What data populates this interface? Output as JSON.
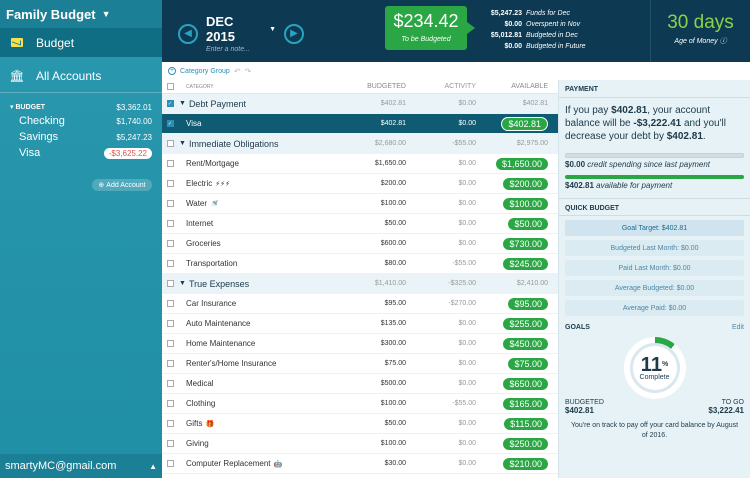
{
  "sidebar": {
    "budget_name": "Family Budget",
    "nav": [
      {
        "label": "Budget",
        "icon": "mail-icon"
      },
      {
        "label": "All Accounts",
        "icon": "bank-icon"
      }
    ],
    "group_label": "BUDGET",
    "group_total": "$3,362.01",
    "accounts": [
      {
        "name": "Checking",
        "balance": "$1,740.00"
      },
      {
        "name": "Savings",
        "balance": "$5,247.23"
      },
      {
        "name": "Visa",
        "balance": "-$3,625.22"
      }
    ],
    "add_account": "Add Account",
    "user_email": "smartyMC@gmail.com"
  },
  "header": {
    "month": "DEC 2015",
    "note_placeholder": "Enter a note...",
    "to_be_budgeted": "$234.42",
    "to_be_budgeted_label": "To be Budgeted",
    "funds": [
      {
        "amount": "$5,247.23",
        "label": "Funds for Dec"
      },
      {
        "amount": "$0.00",
        "label": "Overspent in Nov"
      },
      {
        "amount": "$5,012.81",
        "label": "Budgeted in Dec"
      },
      {
        "amount": "$0.00",
        "label": "Budgeted in Future"
      }
    ],
    "age_of_money": "30 days",
    "age_of_money_label": "Age of Money"
  },
  "toolbar": {
    "category_group": "Category Group"
  },
  "table": {
    "headers": [
      "CATEGORY",
      "BUDGETED",
      "ACTIVITY",
      "AVAILABLE"
    ],
    "rows": [
      {
        "type": "group",
        "name": "Debt Payment",
        "budgeted": "$402.81",
        "activity": "$0.00",
        "available": "$402.81",
        "checked": true
      },
      {
        "type": "item",
        "name": "Visa",
        "budgeted": "$402.81",
        "activity": "$0.00",
        "available": "$402.81",
        "checked": true,
        "selected": true
      },
      {
        "type": "group",
        "name": "Immediate Obligations",
        "budgeted": "$2,680.00",
        "activity": "-$55.00",
        "available": "$2,975.00"
      },
      {
        "type": "item",
        "name": "Rent/Mortgage",
        "budgeted": "$1,650.00",
        "activity": "$0.00",
        "available": "$1,650.00"
      },
      {
        "type": "item",
        "name": "Electric",
        "emoji": "⚡⚡⚡",
        "budgeted": "$200.00",
        "activity": "$0.00",
        "available": "$200.00"
      },
      {
        "type": "item",
        "name": "Water",
        "emoji": "🚿",
        "budgeted": "$100.00",
        "activity": "$0.00",
        "available": "$100.00"
      },
      {
        "type": "item",
        "name": "Internet",
        "budgeted": "$50.00",
        "activity": "$0.00",
        "available": "$50.00"
      },
      {
        "type": "item",
        "name": "Groceries",
        "budgeted": "$600.00",
        "activity": "$0.00",
        "available": "$730.00"
      },
      {
        "type": "item",
        "name": "Transportation",
        "budgeted": "$80.00",
        "activity": "-$55.00",
        "available": "$245.00"
      },
      {
        "type": "group",
        "name": "True Expenses",
        "budgeted": "$1,410.00",
        "activity": "-$325.00",
        "available": "$2,410.00"
      },
      {
        "type": "item",
        "name": "Car Insurance",
        "budgeted": "$95.00",
        "activity": "-$270.00",
        "available": "$95.00"
      },
      {
        "type": "item",
        "name": "Auto Maintenance",
        "budgeted": "$135.00",
        "activity": "$0.00",
        "available": "$255.00"
      },
      {
        "type": "item",
        "name": "Home Maintenance",
        "budgeted": "$300.00",
        "activity": "$0.00",
        "available": "$450.00"
      },
      {
        "type": "item",
        "name": "Renter's/Home Insurance",
        "budgeted": "$75.00",
        "activity": "$0.00",
        "available": "$75.00"
      },
      {
        "type": "item",
        "name": "Medical",
        "budgeted": "$500.00",
        "activity": "$0.00",
        "available": "$650.00"
      },
      {
        "type": "item",
        "name": "Clothing",
        "budgeted": "$100.00",
        "activity": "-$55.00",
        "available": "$165.00"
      },
      {
        "type": "item",
        "name": "Gifts",
        "emoji": "🎁",
        "budgeted": "$50.00",
        "activity": "$0.00",
        "available": "$115.00"
      },
      {
        "type": "item",
        "name": "Giving",
        "budgeted": "$100.00",
        "activity": "$0.00",
        "available": "$250.00"
      },
      {
        "type": "item",
        "name": "Computer Replacement",
        "emoji": "🤖",
        "budgeted": "$30.00",
        "activity": "$0.00",
        "available": "$210.00"
      }
    ]
  },
  "payment": {
    "title": "PAYMENT",
    "text_1": "If you pay ",
    "amount_1": "$402.81",
    "text_2": ", your account balance will be ",
    "amount_2": "-$3,222.41",
    "text_3": " and you'll decrease your debt by ",
    "amount_3": "$402.81",
    "text_4": ".",
    "credit_amount": "$0.00",
    "credit_label": "credit spending since last payment",
    "available_amount": "$402.81",
    "available_label": "available for payment"
  },
  "quick_budget": {
    "title": "QUICK BUDGET",
    "buttons": [
      "Goal Target: $402.81",
      "Budgeted Last Month: $0.00",
      "Paid Last Month: $0.00",
      "Average Budgeted: $0.00",
      "Average Paid: $0.00"
    ]
  },
  "goals": {
    "title": "GOALS",
    "edit": "Edit",
    "percent": "11",
    "percent_sign": "%",
    "complete": "Complete",
    "budgeted_label": "BUDGETED",
    "budgeted_value": "$402.81",
    "to_go_label": "TO GO",
    "to_go_value": "$3,222.41",
    "note": "You're on track to pay off your card balance by August of 2016."
  },
  "colors": {
    "accent": "#2aa744",
    "sidebar": "#2a98ae",
    "header": "#0d3a52"
  }
}
